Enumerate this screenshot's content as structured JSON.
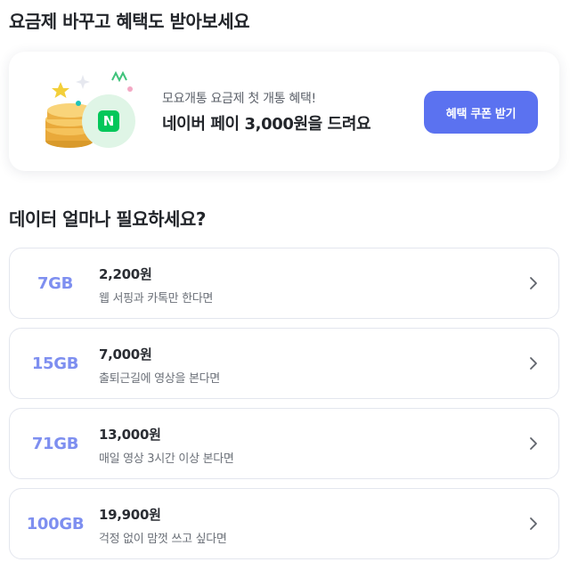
{
  "promo_section": {
    "title": "요금제 바꾸고 혜택도 받아보세요"
  },
  "promo": {
    "subtitle": "모요개통 요금제 첫 개통 혜택!",
    "headline": "네이버 페이 3,000원을 드려요",
    "button_label": "혜택 쿠폰 받기",
    "badge_letter": "N",
    "colors": {
      "accent": "#5b72f0",
      "naver_green": "#03c75a",
      "coin": "#f2b640"
    }
  },
  "plans_section": {
    "title": "데이터 얼마나 필요하세요?"
  },
  "plans": [
    {
      "data": "7GB",
      "price": "2,200원",
      "desc": "웹 서핑과 카톡만 한다면"
    },
    {
      "data": "15GB",
      "price": "7,000원",
      "desc": "출퇴근길에 영상을 본다면"
    },
    {
      "data": "71GB",
      "price": "13,000원",
      "desc": "매일 영상 3시간 이상 본다면"
    },
    {
      "data": "100GB",
      "price": "19,900원",
      "desc": "걱정 없이 맘껏 쓰고 싶다면"
    }
  ]
}
